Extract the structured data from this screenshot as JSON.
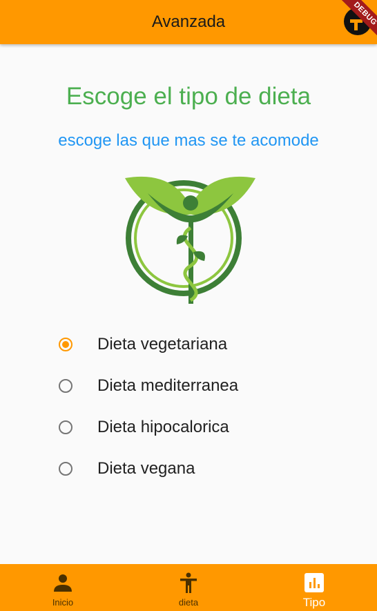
{
  "appbar": {
    "title": "Avanzada",
    "debug_banner": "DEBUG"
  },
  "content": {
    "headline": "Escoge el tipo de dieta",
    "subheadline": "escoge las que mas se te acomode"
  },
  "diet_options": [
    {
      "label": "Dieta vegetariana",
      "selected": true
    },
    {
      "label": "Dieta mediterranea",
      "selected": false
    },
    {
      "label": "Dieta hipocalorica",
      "selected": false
    },
    {
      "label": "Dieta vegana",
      "selected": false
    }
  ],
  "bottom_nav": {
    "items": [
      {
        "label": "Inicio",
        "icon": "person-icon",
        "active": false
      },
      {
        "label": "dieta",
        "icon": "accessibility-icon",
        "active": false
      },
      {
        "label": "Tipo",
        "icon": "bar-chart-icon",
        "active": true
      }
    ]
  },
  "colors": {
    "primary": "#ff9800",
    "headline": "#4caf50",
    "subheadline": "#2196f3",
    "logo_dark_green": "#3d7f36",
    "logo_light_green": "#8dc63f"
  }
}
